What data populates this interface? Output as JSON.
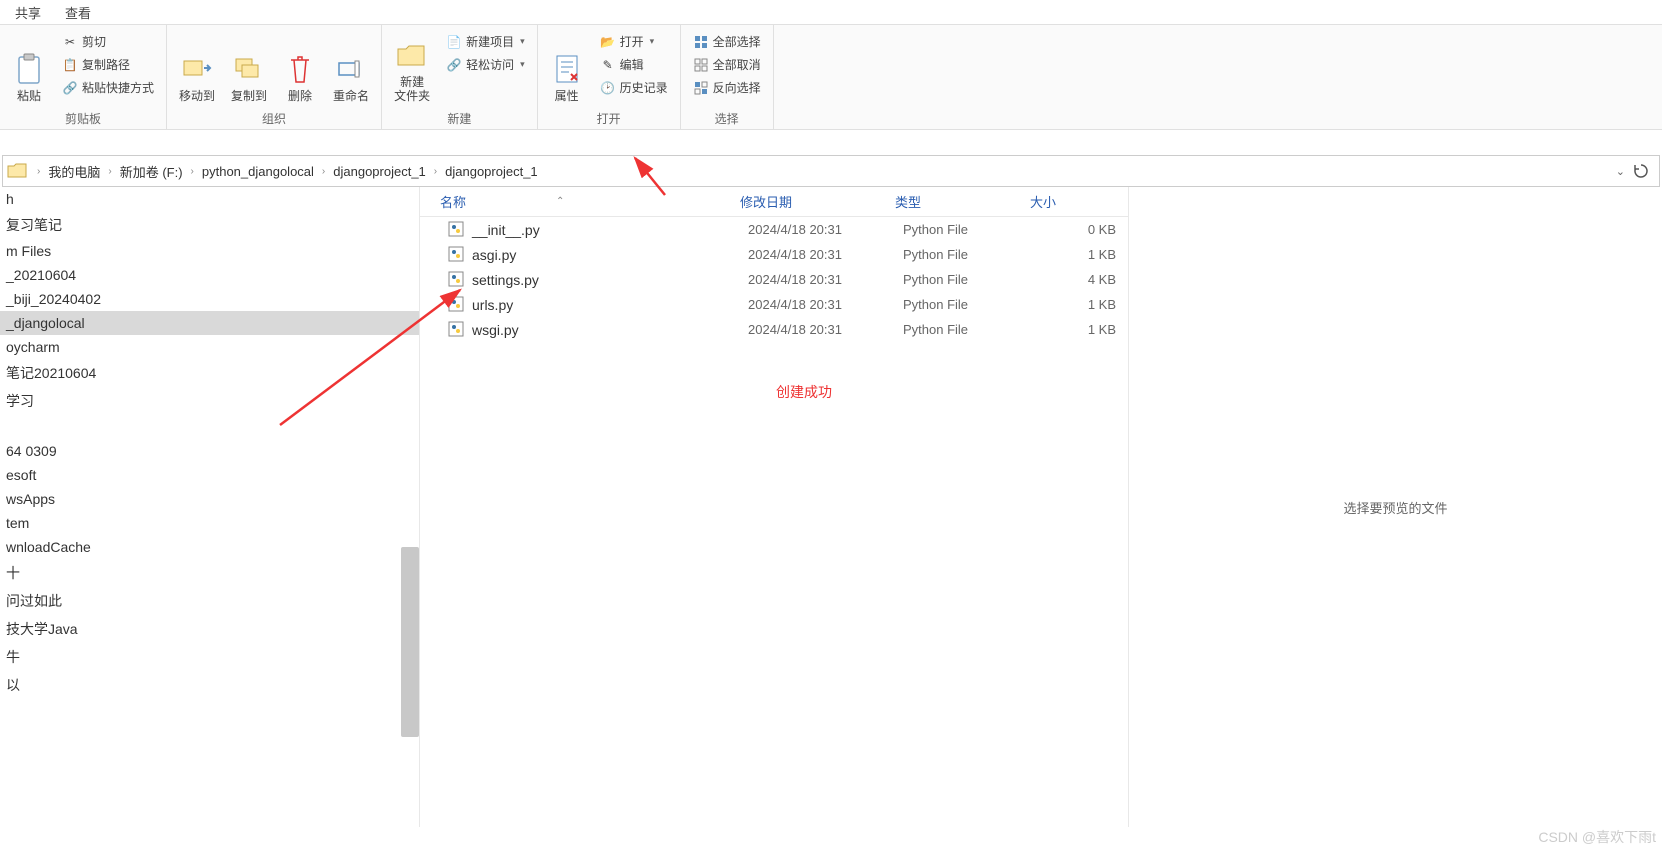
{
  "tabs": {
    "share": "共享",
    "view": "查看"
  },
  "ribbon": {
    "clipboard": {
      "label": "剪贴板",
      "paste": "粘贴",
      "cut": "剪切",
      "copy_path": "复制路径",
      "paste_shortcut": "粘贴快捷方式"
    },
    "organize": {
      "label": "组织",
      "move_to": "移动到",
      "copy_to": "复制到",
      "delete": "删除",
      "rename": "重命名"
    },
    "new": {
      "label": "新建",
      "new_folder": "新建\n文件夹",
      "new_item": "新建项目",
      "easy_access": "轻松访问"
    },
    "open_grp": {
      "label": "打开",
      "properties": "属性",
      "open": "打开",
      "edit": "编辑",
      "history": "历史记录"
    },
    "select": {
      "label": "选择",
      "select_all": "全部选择",
      "select_none": "全部取消",
      "invert": "反向选择"
    }
  },
  "breadcrumb": [
    "我的电脑",
    "新加卷 (F:)",
    "python_djangolocal",
    "djangoproject_1",
    "djangoproject_1"
  ],
  "tree": {
    "items_a": [
      "h",
      "复习笔记",
      "m Files",
      "_20210604",
      "_biji_20240402",
      "_djangolocal",
      "oycharm",
      "笔记20210604",
      "学习"
    ],
    "selected_index": 5,
    "items_b": [
      "64 0309",
      "esoft",
      "wsApps",
      "tem",
      "wnloadCache",
      "十",
      "问过如此",
      "技大学Java",
      "牛",
      "以"
    ]
  },
  "columns": {
    "name": "名称",
    "date": "修改日期",
    "type": "类型",
    "size": "大小"
  },
  "files": [
    {
      "name": "__init__.py",
      "date": "2024/4/18 20:31",
      "type": "Python File",
      "size": "0 KB"
    },
    {
      "name": "asgi.py",
      "date": "2024/4/18 20:31",
      "type": "Python File",
      "size": "1 KB"
    },
    {
      "name": "settings.py",
      "date": "2024/4/18 20:31",
      "type": "Python File",
      "size": "4 KB"
    },
    {
      "name": "urls.py",
      "date": "2024/4/18 20:31",
      "type": "Python File",
      "size": "1 KB"
    },
    {
      "name": "wsgi.py",
      "date": "2024/4/18 20:31",
      "type": "Python File",
      "size": "1 KB"
    }
  ],
  "annotation": "创建成功",
  "preview_hint": "选择要预览的文件",
  "watermark": "CSDN @喜欢下雨t"
}
